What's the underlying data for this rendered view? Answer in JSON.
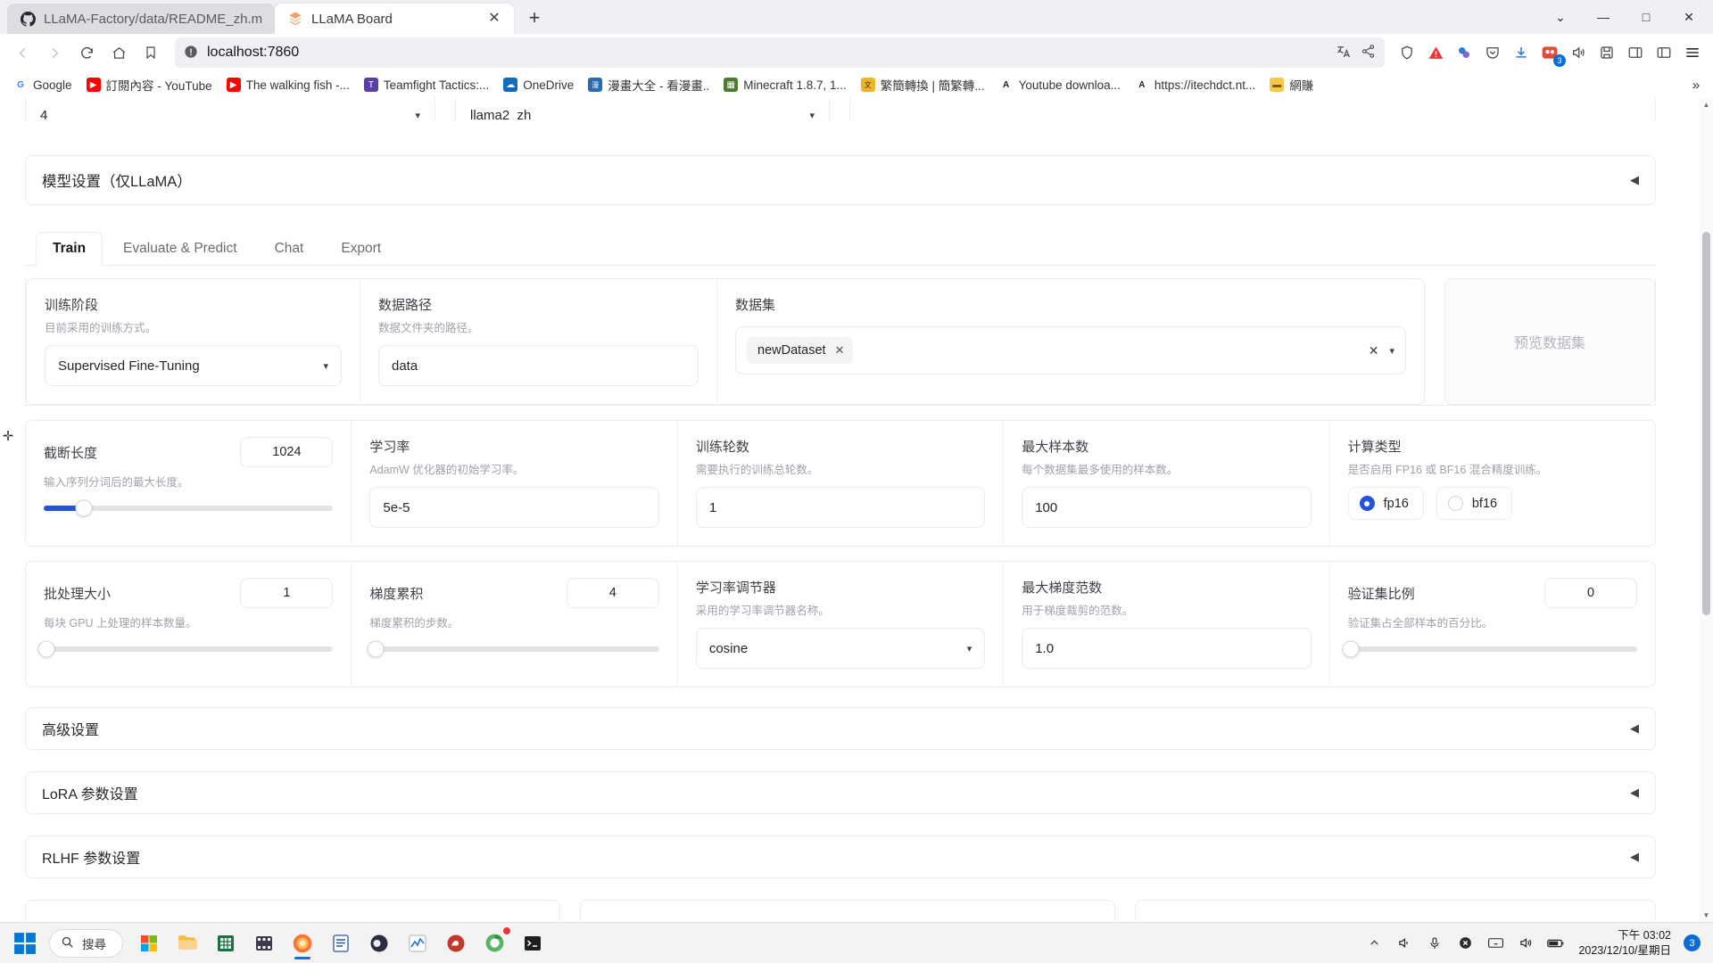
{
  "browser": {
    "tabs": [
      {
        "title": "LLaMA-Factory/data/README_zh.m",
        "favicon": "github-icon",
        "active": false
      },
      {
        "title": "LLaMA Board",
        "favicon": "llama-board-icon",
        "active": true
      }
    ],
    "new_tab_label": "+",
    "window_controls": {
      "list_all_tabs": "⌄",
      "minimize": "—",
      "maximize": "□",
      "close": "✕"
    },
    "nav": {
      "back": "‹",
      "forward": "›",
      "reload": "⟳",
      "home": "⌂",
      "bookmark": "🔖"
    },
    "address": {
      "value": "localhost:7860",
      "security_icon": "not-secure-icon"
    },
    "url_actions": {
      "translate": "translate-icon",
      "share": "share-icon",
      "shield": "shield-icon",
      "adblock": "adblock-icon",
      "extension": "extension-icon",
      "pocket": "pocket-icon",
      "download": "download-icon",
      "account": "account-icon",
      "audio": "audio-icon",
      "save": "save-icon",
      "sidebar": "sidebar-icon",
      "reader": "reader-icon",
      "menu": "menu-icon"
    },
    "bookmarks": [
      {
        "label": "Google",
        "color": "#4285f4",
        "glyph": "G"
      },
      {
        "label": "訂閱內容 - YouTube",
        "color": "#ff0000",
        "glyph": "▶"
      },
      {
        "label": "The walking fish -...",
        "color": "#ff0000",
        "glyph": "▶"
      },
      {
        "label": "Teamfight Tactics:...",
        "color": "#5b3fa8",
        "glyph": "T"
      },
      {
        "label": "OneDrive",
        "color": "#0f6cbd",
        "glyph": "☁"
      },
      {
        "label": "漫畫大全 - 看漫畫..",
        "color": "#2b6cb0",
        "glyph": "漫"
      },
      {
        "label": "Minecraft 1.8.7, 1...",
        "color": "#4a7c2f",
        "glyph": "▦"
      },
      {
        "label": "繁簡轉換 | 簡繁轉...",
        "color": "#f0b429",
        "glyph": "文"
      },
      {
        "label": "Youtube downloa...",
        "color": "#333333",
        "glyph": "A"
      },
      {
        "label": "https://itechdct.nt...",
        "color": "#333333",
        "glyph": "A"
      },
      {
        "label": "網賺",
        "color": "#f7c948",
        "glyph": "📁"
      }
    ],
    "bookmarks_overflow": "»"
  },
  "app": {
    "top_cut_row": {
      "left_value": "4",
      "middle_value": "llama2_zh"
    },
    "model_settings": {
      "title": "模型设置（仅LLaMA）",
      "caret": "◀"
    },
    "tabs": [
      {
        "label": "Train",
        "active": true
      },
      {
        "label": "Evaluate & Predict",
        "active": false
      },
      {
        "label": "Chat",
        "active": false
      },
      {
        "label": "Export",
        "active": false
      }
    ],
    "row1": {
      "stage": {
        "label": "训练阶段",
        "hint": "目前采用的训练方式。",
        "value": "Supervised Fine-Tuning",
        "caret": "▾"
      },
      "data_path": {
        "label": "数据路径",
        "hint": "数据文件夹的路径。",
        "value": "data"
      },
      "dataset": {
        "label": "数据集",
        "chips": [
          {
            "text": "newDataset",
            "remove": "✕"
          }
        ],
        "clear": "✕",
        "caret": "▾"
      },
      "preview_button": "预览数据集"
    },
    "row2": {
      "cutoff_len": {
        "label": "截断长度",
        "hint": "输入序列分词后的最大长度。",
        "value": "1024",
        "slider_pct": 14
      },
      "learning_rate": {
        "label": "学习率",
        "hint": "AdamW 优化器的初始学习率。",
        "value": "5e-5"
      },
      "epochs": {
        "label": "训练轮数",
        "hint": "需要执行的训练总轮数。",
        "value": "1"
      },
      "max_samples": {
        "label": "最大样本数",
        "hint": "每个数据集最多使用的样本数。",
        "value": "100"
      },
      "compute_type": {
        "label": "计算类型",
        "hint": "是否启用 FP16 或 BF16 混合精度训练。",
        "options": [
          {
            "label": "fp16",
            "selected": true
          },
          {
            "label": "bf16",
            "selected": false
          }
        ]
      }
    },
    "row3": {
      "batch_size": {
        "label": "批处理大小",
        "hint": "每块 GPU 上处理的样本数量。",
        "value": "1",
        "slider_pct": 1
      },
      "grad_accum": {
        "label": "梯度累积",
        "hint": "梯度累积的步数。",
        "value": "4",
        "slider_pct": 2
      },
      "lr_scheduler": {
        "label": "学习率调节器",
        "hint": "采用的学习率调节器名称。",
        "value": "cosine",
        "caret": "▾"
      },
      "max_grad_norm": {
        "label": "最大梯度范数",
        "hint": "用于梯度裁剪的范数。",
        "value": "1.0"
      },
      "val_size": {
        "label": "验证集比例",
        "hint": "验证集占全部样本的百分比。",
        "value": "0",
        "slider_pct": 1
      }
    },
    "accordions": [
      {
        "label": "高级设置",
        "caret": "◀"
      },
      {
        "label": "LoRA 参数设置",
        "caret": "◀"
      },
      {
        "label": "RLHF 参数设置",
        "caret": "◀"
      }
    ]
  },
  "taskbar": {
    "start": "windows-icon",
    "search_placeholder": "搜尋",
    "apps": [
      {
        "name": "microsoft-store-icon",
        "active": false
      },
      {
        "name": "file-explorer-icon",
        "active": false
      },
      {
        "name": "excel-icon",
        "active": false
      },
      {
        "name": "video-editor-icon",
        "active": false
      },
      {
        "name": "firefox-icon",
        "active": true
      },
      {
        "name": "text-editor-icon",
        "active": false
      },
      {
        "name": "obs-icon",
        "active": false
      },
      {
        "name": "chart-app-icon",
        "active": false
      },
      {
        "name": "anaconda-icon",
        "active": false
      },
      {
        "name": "browser-app-icon",
        "active": false
      },
      {
        "name": "terminal-icon",
        "active": false
      }
    ],
    "tray": {
      "show_hidden": "chevron-up-icon",
      "sound": "volume-icon",
      "microphone": "microphone-icon",
      "close_x": "close-icon",
      "keyboard": "keyboard-icon",
      "volume2": "speaker-icon",
      "battery": "battery-icon"
    },
    "clock": {
      "time": "下午 03:02",
      "date": "2023/12/10/星期日"
    },
    "notification_count": "3"
  }
}
